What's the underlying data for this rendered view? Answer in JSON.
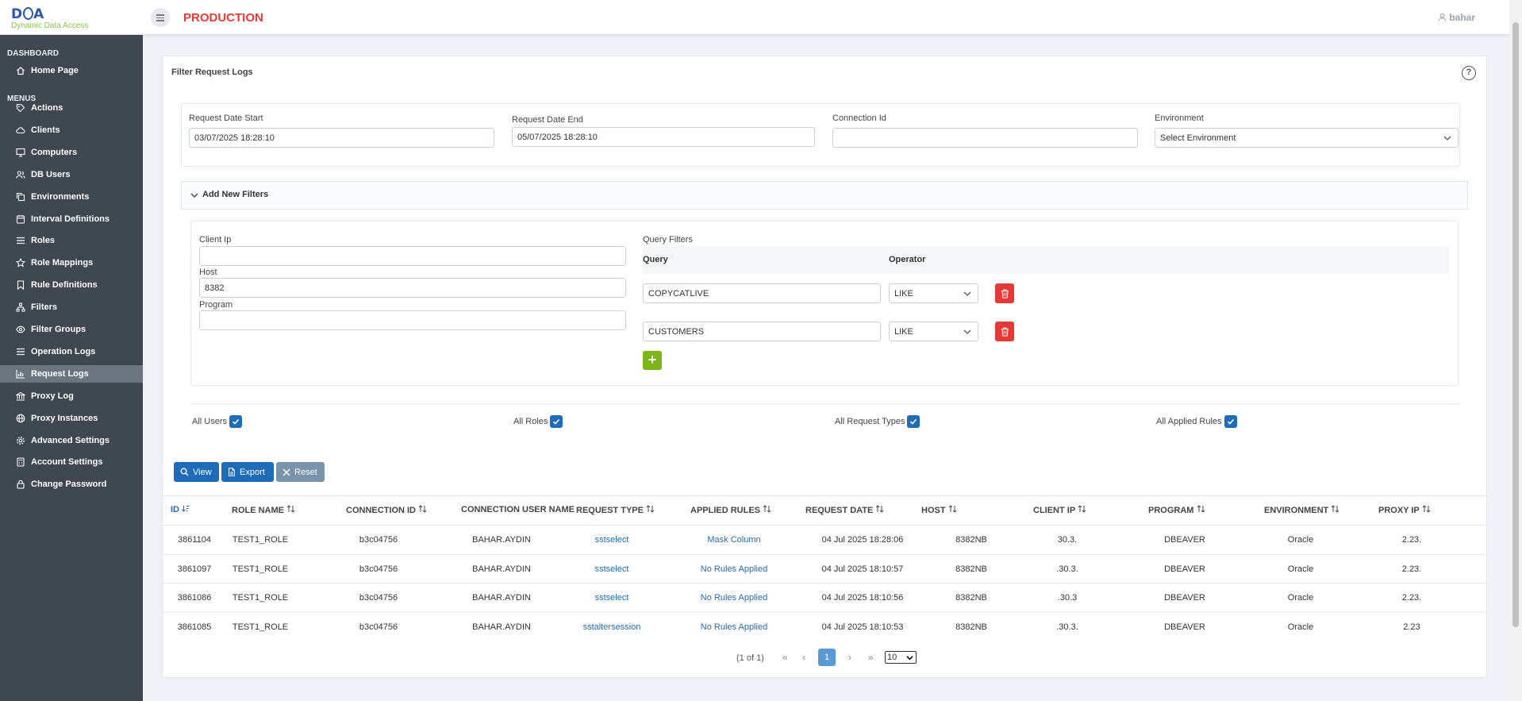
{
  "header": {
    "logo_main": "DDA",
    "logo_sub": "Dynamic Data Access",
    "env_title": "PRODUCTION",
    "user": "bahar"
  },
  "sidebar": {
    "dashboard_head": "DASHBOARD",
    "menus_head": "MENUS",
    "home": "Home Page",
    "items": [
      {
        "label": "Actions",
        "icon": "tag-icon"
      },
      {
        "label": "Clients",
        "icon": "cloud-icon"
      },
      {
        "label": "Computers",
        "icon": "monitor-icon"
      },
      {
        "label": "DB Users",
        "icon": "users-icon"
      },
      {
        "label": "Environments",
        "icon": "copy-icon"
      },
      {
        "label": "Interval Definitions",
        "icon": "calendar-icon"
      },
      {
        "label": "Roles",
        "icon": "list-icon"
      },
      {
        "label": "Role Mappings",
        "icon": "star-icon"
      },
      {
        "label": "Rule Definitions",
        "icon": "bookmark-icon"
      },
      {
        "label": "Filters",
        "icon": "sitemap-icon"
      },
      {
        "label": "Filter Groups",
        "icon": "eye-icon"
      },
      {
        "label": "Operation Logs",
        "icon": "list-icon"
      },
      {
        "label": "Request Logs",
        "icon": "chart-icon"
      },
      {
        "label": "Proxy Log",
        "icon": "bank-icon"
      },
      {
        "label": "Proxy Instances",
        "icon": "globe-icon"
      },
      {
        "label": "Advanced Settings",
        "icon": "cog-icon"
      },
      {
        "label": "Account Settings",
        "icon": "calculator-icon"
      },
      {
        "label": "Change Password",
        "icon": "lock-icon"
      }
    ],
    "active_index": 12
  },
  "filter": {
    "title": "Filter Request Logs",
    "date_start_label": "Request Date Start",
    "date_start_value": "03/07/2025 18:28:10",
    "date_end_label": "Request Date End",
    "date_end_value": "05/07/2025 18:28:10",
    "connection_label": "Connection Id",
    "connection_value": "",
    "environment_label": "Environment",
    "environment_value": "Select Environment",
    "add_filters_title": "Add New Filters",
    "client_ip_label": "Client Ip",
    "client_ip_value": "",
    "host_label": "Host",
    "host_value": "8382",
    "program_label": "Program",
    "program_value": "",
    "query_filters_label": "Query Filters",
    "query_col": "Query",
    "operator_col": "Operator",
    "queries": [
      {
        "query": "COPYCATLIVE",
        "operator": "LIKE"
      },
      {
        "query": "CUSTOMERS",
        "operator": "LIKE"
      }
    ],
    "add_symbol": "+",
    "all_users": "All Users",
    "all_roles": "All Roles",
    "all_request_types": "All Request Types",
    "all_applied_rules": "All Applied Rules"
  },
  "actions": {
    "view": "View",
    "export": "Export",
    "reset": "Reset"
  },
  "table": {
    "columns": [
      "ID",
      "ROLE NAME",
      "CONNECTION ID",
      "CONNECTION USER NAME",
      "REQUEST TYPE",
      "APPLIED RULES",
      "REQUEST DATE",
      "HOST",
      "CLIENT IP",
      "PROGRAM",
      "ENVIRONMENT",
      "PROXY IP"
    ],
    "rows": [
      [
        "3861104",
        "TEST1_ROLE",
        "b3c04756",
        "BAHAR.AYDIN",
        "sstselect",
        "Mask Column",
        "04 Jul 2025 18:28:06",
        "8382NB",
        "30.3.",
        "DBEAVER",
        "Oracle",
        "2.23."
      ],
      [
        "3861097",
        "TEST1_ROLE",
        "b3c04756",
        "BAHAR.AYDIN",
        "sstselect",
        "No Rules Applied",
        "04 Jul 2025 18:10:57",
        "8382NB",
        ".30.3.",
        "DBEAVER",
        "Oracle",
        "2.23."
      ],
      [
        "3861086",
        "TEST1_ROLE",
        "b3c04756",
        "BAHAR.AYDIN",
        "sstselect",
        "No Rules Applied",
        "04 Jul 2025 18:10:56",
        "8382NB",
        ".30.3",
        "DBEAVER",
        "Oracle",
        "2.23."
      ],
      [
        "3861085",
        "TEST1_ROLE",
        "b3c04756",
        "BAHAR.AYDIN",
        "sstaltersession",
        "No Rules Applied",
        "04 Jul 2025 18:10:53",
        "8382NB",
        ".30.3.",
        "DBEAVER",
        "Oracle",
        "2.23"
      ]
    ],
    "pager_text": "(1 of 1)",
    "current_page": "1",
    "page_size": "10"
  }
}
